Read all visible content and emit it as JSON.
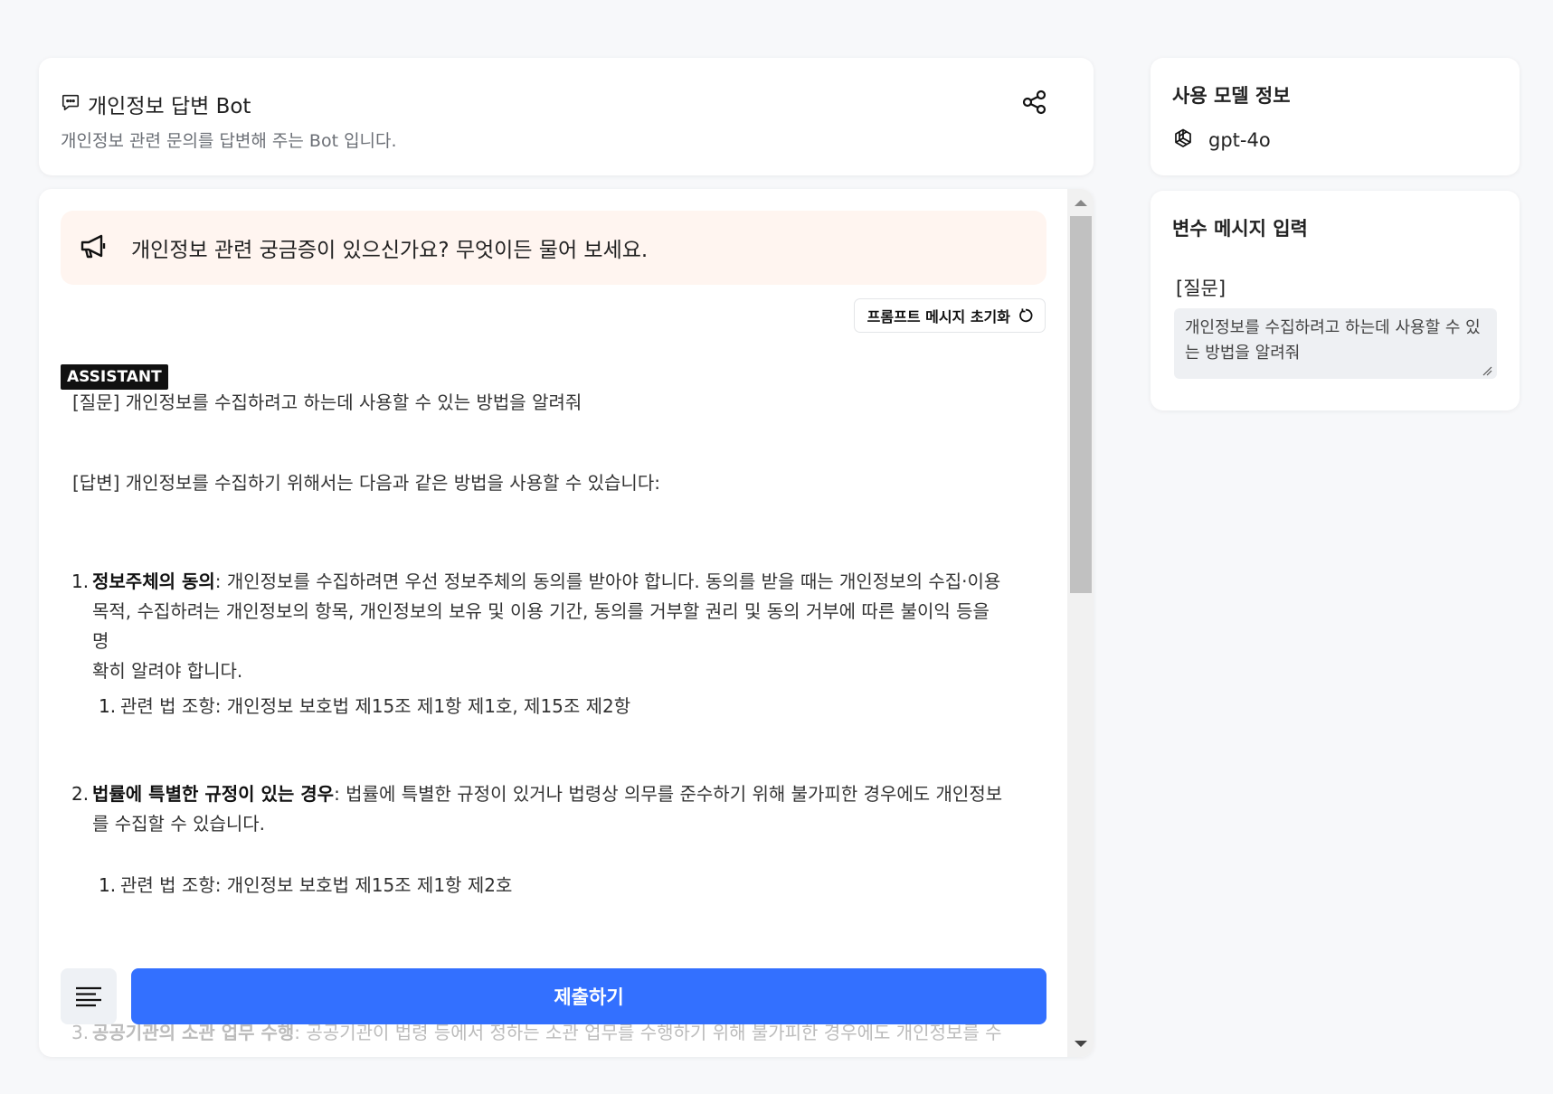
{
  "header": {
    "title": "개인정보 답변 Bot",
    "subtitle": "개인정보 관련 문의를 답변해 주는 Bot 입니다."
  },
  "chat": {
    "notice": "개인정보 관련 궁금증이 있으신가요? 무엇이든 물어 보세요.",
    "reset_label": "프롬프트 메시지 초기화",
    "role": "ASSISTANT",
    "question_line": "[질문] 개인정보를 수집하려고 하는데 사용할 수 있는 방법을 알려줘",
    "answer_intro": "[답변] 개인정보를 수집하기 위해서는 다음과 같은 방법을 사용할 수 있습니다:",
    "items": [
      {
        "num": "1.",
        "bold": "정보주체의 동의",
        "text_line1": ": 개인정보를 수집하려면 우선 정보주체의 동의를 받아야 합니다. 동의를 받을 때는 개인정보의 수집·이용",
        "text_line2": "목적, 수집하려는 개인정보의 항목, 개인정보의 보유 및 이용 기간, 동의를 거부할 권리 및 동의 거부에 따른 불이익 등을 명",
        "text_line3": "확히 알려야 합니다.",
        "sub_num": "1.",
        "sub_text": "관련 법 조항: 개인정보 보호법 제15조 제1항 제1호, 제15조 제2항"
      },
      {
        "num": "2.",
        "bold": "법률에 특별한 규정이 있는 경우",
        "text_line1": ": 법률에 특별한 규정이 있거나 법령상 의무를 준수하기 위해 불가피한 경우에도 개인정보",
        "text_line2": "를 수집할 수 있습니다.",
        "sub_num": "1.",
        "sub_text": "관련 법 조항: 개인정보 보호법 제15조 제1항 제2호"
      },
      {
        "num": "3.",
        "bold": "공공기관의 소관 업무 수행",
        "text_line1": ": 공공기관이 법령 등에서 정하는 소관 업무를 수행하기 위해 불가피한 경우에도 개인정보를 수"
      }
    ],
    "submit_label": "제출하기"
  },
  "model": {
    "title": "사용 모델 정보",
    "name": "gpt-4o"
  },
  "variables": {
    "title": "변수 메시지 입력",
    "label": "[질문]",
    "value": "개인정보를 수집하려고 하는데 사용할 수 있는 방법을 알려줘"
  },
  "colors": {
    "accent": "#3370ff",
    "notice_bg": "#fff5f0",
    "badge_bg": "#111111"
  },
  "icons": {
    "title": "chat-bubble-icon",
    "share": "share-icon",
    "notice": "megaphone-icon",
    "reset": "refresh-icon",
    "menu": "menu-lines-icon",
    "model": "openai-logo-icon"
  }
}
